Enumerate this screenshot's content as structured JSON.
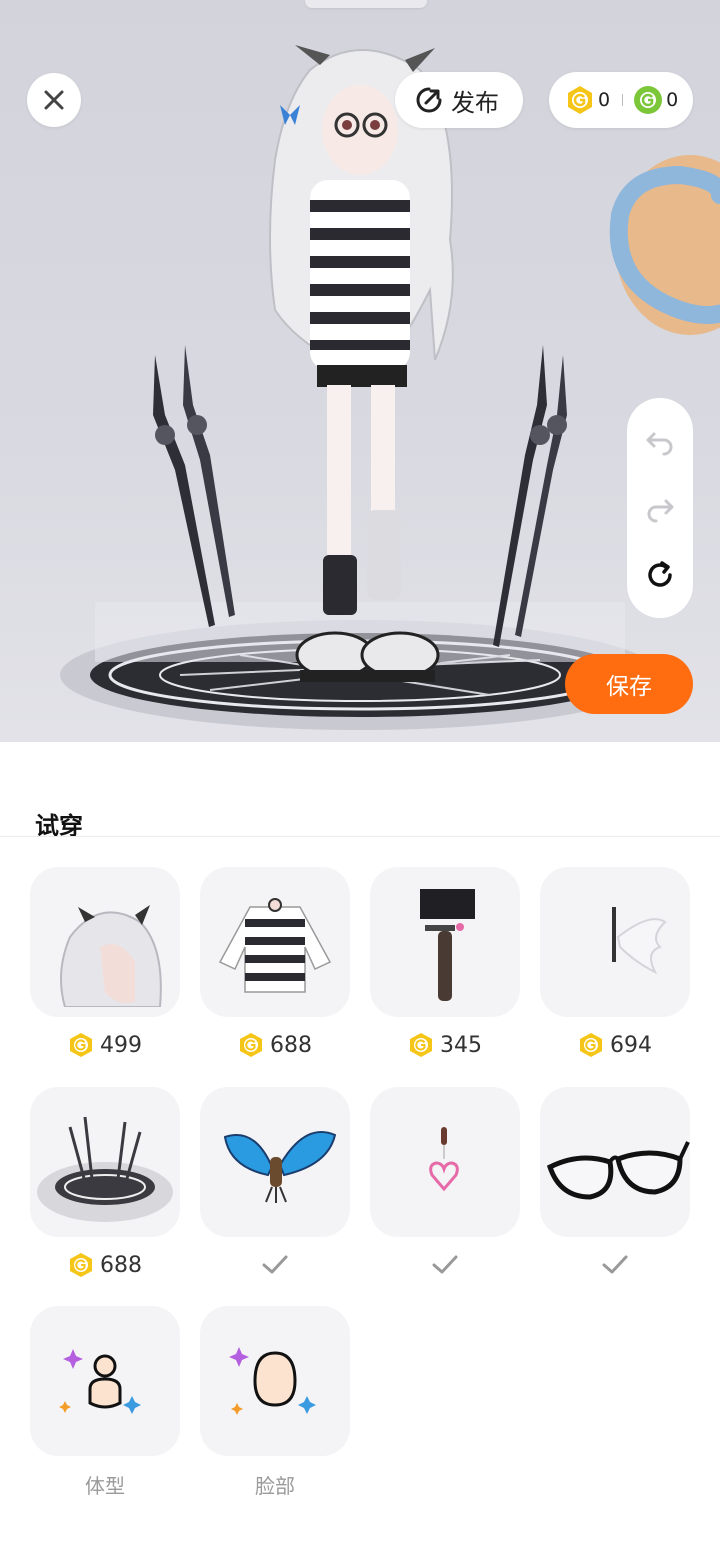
{
  "toolbar": {
    "publish_label": "发布",
    "gold_balance": "0",
    "green_balance": "0",
    "save_label": "保存"
  },
  "try_on": {
    "title": "试穿",
    "items": [
      {
        "name": "hair",
        "price": "499"
      },
      {
        "name": "striped-sweater",
        "price": "688"
      },
      {
        "name": "shorts-stockings",
        "price": "345"
      },
      {
        "name": "wings",
        "price": "694"
      },
      {
        "name": "sword-circle-effect",
        "price": "688"
      },
      {
        "name": "butterfly",
        "owned": true
      },
      {
        "name": "heart-earring",
        "owned": true
      },
      {
        "name": "glasses",
        "owned": true
      }
    ],
    "categories": [
      {
        "label": "体型"
      },
      {
        "label": "脸部"
      }
    ]
  },
  "colors": {
    "accent": "#ff6d10",
    "coin_gold": "#f5c518",
    "coin_green": "#7cc63a"
  }
}
